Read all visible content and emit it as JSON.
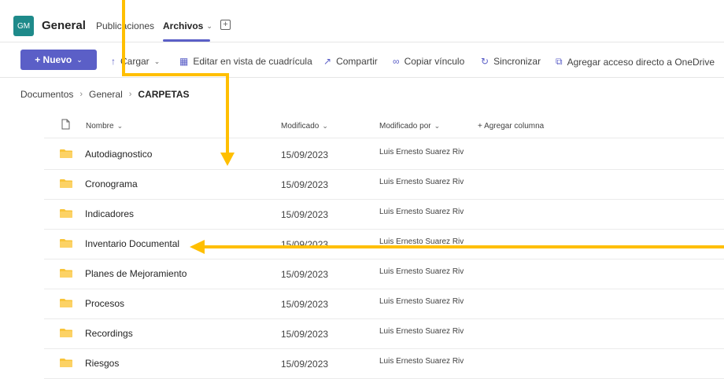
{
  "header": {
    "team_initials": "GM",
    "channel_name": "General",
    "tabs": [
      {
        "label": "Publicaciones"
      },
      {
        "label": "Archivos"
      }
    ],
    "add_tab_symbol": "+"
  },
  "toolbar": {
    "new_label": "+ Nuevo",
    "items": [
      {
        "label": "Cargar",
        "icon": "upload-icon"
      },
      {
        "label": "Editar en vista de cuadrícula",
        "icon": "grid-icon"
      },
      {
        "label": "Compartir",
        "icon": "share-icon"
      },
      {
        "label": "Copiar vínculo",
        "icon": "link-icon"
      },
      {
        "label": "Sincronizar",
        "icon": "sync-icon"
      },
      {
        "label": "Agregar acceso directo a OneDrive",
        "icon": "shortcut-icon"
      }
    ]
  },
  "breadcrumb": {
    "items": [
      "Documentos",
      "General",
      "CARPETAS"
    ]
  },
  "table": {
    "columns": {
      "name": "Nombre",
      "modified": "Modificado",
      "modified_by": "Modificado por",
      "add_column": "+ Agregar columna"
    },
    "rows": [
      {
        "name": "Autodiagnostico",
        "modified": "15/09/2023",
        "modified_by": "Luis Ernesto Suarez Riv"
      },
      {
        "name": "Cronograma",
        "modified": "15/09/2023",
        "modified_by": "Luis Ernesto Suarez Riv"
      },
      {
        "name": "Indicadores",
        "modified": "15/09/2023",
        "modified_by": "Luis Ernesto Suarez Riv"
      },
      {
        "name": "Inventario Documental",
        "modified": "15/09/2023",
        "modified_by": "Luis Ernesto Suarez Riv"
      },
      {
        "name": "Planes de Mejoramiento",
        "modified": "15/09/2023",
        "modified_by": "Luis Ernesto Suarez Riv"
      },
      {
        "name": "Procesos",
        "modified": "15/09/2023",
        "modified_by": "Luis Ernesto Suarez Riv"
      },
      {
        "name": "Recordings",
        "modified": "15/09/2023",
        "modified_by": "Luis Ernesto Suarez Riv"
      },
      {
        "name": "Riesgos",
        "modified": "15/09/2023",
        "modified_by": "Luis Ernesto Suarez Riv"
      }
    ]
  },
  "colors": {
    "accent": "#5b5fc7",
    "folder": "#f8c43a",
    "annotation_arrow": "#ffbf00",
    "avatar": "#1e8a8a"
  }
}
